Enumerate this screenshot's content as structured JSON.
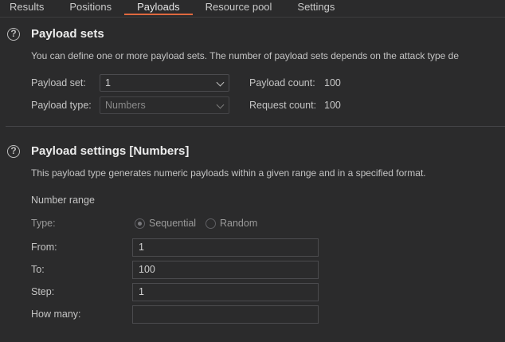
{
  "tabs": [
    {
      "label": "Results"
    },
    {
      "label": "Positions"
    },
    {
      "label": "Payloads"
    },
    {
      "label": "Resource pool"
    },
    {
      "label": "Settings"
    }
  ],
  "active_tab": "Payloads",
  "payload_sets": {
    "title": "Payload sets",
    "description": "You can define one or more payload sets. The number of payload sets depends on the attack type de",
    "payload_set_label": "Payload set:",
    "payload_set_value": "1",
    "payload_type_label": "Payload type:",
    "payload_type_value": "Numbers",
    "payload_count_label": "Payload count:",
    "payload_count_value": "100",
    "request_count_label": "Request count:",
    "request_count_value": "100"
  },
  "payload_settings": {
    "title": "Payload settings [Numbers]",
    "description": "This payload type generates numeric payloads within a given range and in a specified format.",
    "number_range_label": "Number range",
    "type_label": "Type:",
    "type_options": [
      {
        "label": "Sequential",
        "selected": true
      },
      {
        "label": "Random",
        "selected": false
      }
    ],
    "from_label": "From:",
    "from_value": "1",
    "to_label": "To:",
    "to_value": "100",
    "step_label": "Step:",
    "step_value": "1",
    "how_many_label": "How many:",
    "how_many_value": ""
  },
  "colors": {
    "background": "#2b2b2c",
    "accent": "#e0683e",
    "text": "#c9c9c9"
  }
}
